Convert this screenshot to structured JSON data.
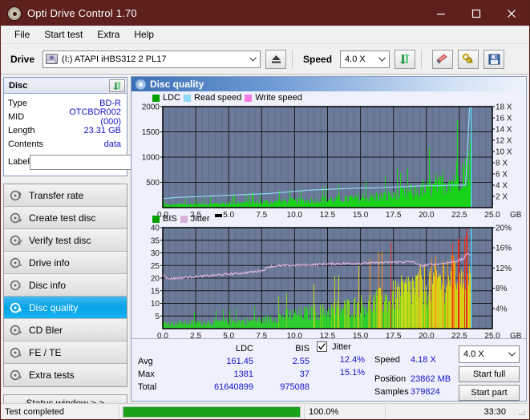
{
  "window": {
    "title": "Opti Drive Control 1.70",
    "icon": "disc-icon",
    "minimize": "minimize-icon",
    "maximize": "maximize-icon",
    "close": "close-icon",
    "titlebar_color": "#5e201c"
  },
  "menu": {
    "items": [
      "File",
      "Start test",
      "Extra",
      "Help"
    ]
  },
  "toolbar": {
    "drive_label": "Drive",
    "drive_value": "(I:)  ATAPI iHBS312   2 PL17",
    "eject_icon": "eject-icon",
    "speed_label": "Speed",
    "speed_value": "4.0 X",
    "refresh_icon": "refresh-icon",
    "eraser_icon": "eraser-icon",
    "keys_icon": "keys-icon",
    "save_icon": "save-icon"
  },
  "disc": {
    "header": "Disc",
    "refresh_icon": "refresh-icon",
    "rows": [
      {
        "key": "Type",
        "value": "BD-R"
      },
      {
        "key": "MID",
        "value": "OTCBDR002 (000)"
      },
      {
        "key": "Length",
        "value": "23.31 GB"
      },
      {
        "key": "Contents",
        "value": "data"
      }
    ],
    "label_key": "Label",
    "label_value": "",
    "label_button_icon": "disc-icon"
  },
  "nav": {
    "items": [
      {
        "label": "Transfer rate",
        "selected": false
      },
      {
        "label": "Create test disc",
        "selected": false
      },
      {
        "label": "Verify test disc",
        "selected": false
      },
      {
        "label": "Drive info",
        "selected": false
      },
      {
        "label": "Disc info",
        "selected": false
      },
      {
        "label": "Disc quality",
        "selected": true
      },
      {
        "label": "CD Bler",
        "selected": false
      },
      {
        "label": "FE / TE",
        "selected": false
      },
      {
        "label": "Extra tests",
        "selected": false
      }
    ],
    "status_window": "Status window > >"
  },
  "panel": {
    "title": "Disc quality",
    "icon": "disc-icon"
  },
  "results": {
    "col_ldc": "LDC",
    "col_bis": "BIS",
    "jitter_label": "Jitter",
    "jitter_checked": true,
    "rows": [
      {
        "name": "Avg",
        "ldc": "161.45",
        "bis": "2.55",
        "jitter": "12.4%"
      },
      {
        "name": "Max",
        "ldc": "1381",
        "bis": "37",
        "jitter": "15.1%"
      },
      {
        "name": "Total",
        "ldc": "61640899",
        "bis": "975088",
        "jitter": ""
      }
    ],
    "speed_label": "Speed",
    "speed_value": "4.18 X",
    "speed_select": "4.0 X",
    "position_label": "Position",
    "position_value": "23862 MB",
    "samples_label": "Samples",
    "samples_value": "379824",
    "start_full": "Start full",
    "start_part": "Start part"
  },
  "statusbar": {
    "message": "Test completed",
    "percent_text": "100.0%",
    "percent_value": 100,
    "elapsed": "33:30"
  },
  "chart_data": [
    {
      "type": "area",
      "id": "ldc-chart",
      "title": "",
      "xlabel": "GB",
      "ylabel": "",
      "xlim": [
        0,
        25.0
      ],
      "ylim": [
        0,
        2000
      ],
      "y2lim": [
        0,
        18
      ],
      "y2label": "X",
      "grid": true,
      "legend": [
        {
          "name": "LDC",
          "color": "#00a000"
        },
        {
          "name": "Read speed",
          "color": "#8fd8f5"
        },
        {
          "name": "Write speed",
          "color": "#f57ce0"
        }
      ],
      "xticks": [
        "0.0",
        "2.5",
        "5.0",
        "7.5",
        "10.0",
        "12.5",
        "15.0",
        "17.5",
        "20.0",
        "22.5",
        "25.0"
      ],
      "yticks": [
        "500",
        "1000",
        "1500",
        "2000"
      ],
      "y2ticks": [
        "2 X",
        "4 X",
        "6 X",
        "8 X",
        "10 X",
        "12 X",
        "14 X",
        "16 X",
        "18 X"
      ],
      "plot_bg": "#6b7a99",
      "series": [
        {
          "name": "LDC",
          "color": "#00c000",
          "x": [
            0.0,
            0.25,
            0.5,
            0.75,
            1.0,
            1.25,
            1.5,
            1.75,
            2.0,
            2.25,
            2.5,
            2.75,
            3.0,
            3.25,
            3.5,
            3.75,
            4.0,
            4.25,
            4.5,
            4.75,
            5.0,
            5.25,
            5.5,
            5.75,
            6.0,
            6.25,
            6.5,
            6.75,
            7.0,
            7.25,
            7.5,
            7.75,
            8.0,
            8.25,
            8.5,
            8.75,
            9.0,
            9.25,
            9.5,
            9.75,
            10.0,
            10.25,
            10.5,
            10.75,
            11.0,
            11.25,
            11.5,
            11.75,
            12.0,
            12.25,
            12.5,
            12.75,
            13.0,
            13.25,
            13.5,
            13.75,
            14.0,
            14.25,
            14.5,
            14.75,
            15.0,
            15.25,
            15.5,
            15.75,
            16.0,
            16.25,
            16.5,
            16.75,
            17.0,
            17.25,
            17.5,
            17.75,
            18.0,
            18.25,
            18.5,
            18.75,
            19.0,
            19.25,
            19.5,
            19.75,
            20.0,
            20.25,
            20.5,
            20.75,
            21.0,
            21.25,
            21.5,
            21.75,
            22.0,
            22.25,
            22.5,
            22.75,
            23.0,
            23.2,
            23.35
          ],
          "values": [
            70,
            80,
            70,
            85,
            75,
            90,
            80,
            95,
            85,
            100,
            90,
            105,
            95,
            110,
            100,
            115,
            105,
            120,
            110,
            125,
            115,
            130,
            120,
            135,
            125,
            140,
            130,
            145,
            135,
            150,
            140,
            155,
            145,
            165,
            150,
            175,
            155,
            185,
            160,
            190,
            165,
            195,
            170,
            200,
            175,
            205,
            180,
            215,
            185,
            225,
            190,
            235,
            195,
            245,
            200,
            255,
            210,
            265,
            220,
            280,
            230,
            295,
            240,
            310,
            250,
            330,
            265,
            350,
            280,
            375,
            300,
            400,
            320,
            430,
            345,
            465,
            370,
            505,
            400,
            550,
            440,
            600,
            490,
            665,
            545,
            740,
            615,
            830,
            700,
            940,
            800,
            1080,
            950,
            1250,
            1381
          ]
        },
        {
          "name": "Read speed",
          "color": "#8fd8f5",
          "x": [
            0.0,
            1.0,
            2.0,
            3.0,
            4.0,
            5.0,
            6.0,
            7.0,
            8.0,
            9.0,
            10.0,
            11.0,
            12.0,
            13.0,
            14.0,
            15.0,
            16.0,
            17.0,
            18.0,
            19.0,
            20.0,
            21.0,
            22.0,
            23.0,
            23.3
          ],
          "values": [
            1.6,
            1.8,
            1.9,
            2.0,
            2.1,
            2.2,
            2.3,
            2.4,
            2.5,
            2.7,
            2.9,
            3.1,
            3.2,
            3.3,
            3.4,
            3.5,
            3.5,
            3.6,
            3.7,
            3.8,
            3.9,
            3.9,
            4.0,
            4.0,
            18.0
          ],
          "axis": "right"
        }
      ]
    },
    {
      "type": "area",
      "id": "bis-jitter-chart",
      "title": "",
      "xlabel": "GB",
      "xlim": [
        0,
        25.0
      ],
      "ylim": [
        0,
        40
      ],
      "y2lim": [
        0,
        20
      ],
      "y2label": "%",
      "grid": true,
      "legend": [
        {
          "name": "BIS",
          "color": "#00a000"
        },
        {
          "name": "Jitter",
          "color": "#dcb0dc"
        }
      ],
      "xticks": [
        "0.0",
        "2.5",
        "5.0",
        "7.5",
        "10.0",
        "12.5",
        "15.0",
        "17.5",
        "20.0",
        "22.5",
        "25.0"
      ],
      "yticks": [
        "5",
        "10",
        "15",
        "20",
        "25",
        "30",
        "35",
        "40"
      ],
      "y2ticks": [
        "4%",
        "8%",
        "12%",
        "16%",
        "20%"
      ],
      "plot_bg": "#6b7a99",
      "series": [
        {
          "name": "BIS",
          "color": "gradient-green-yellow-red",
          "x": [
            0.0,
            0.5,
            1.0,
            1.5,
            2.0,
            2.5,
            3.0,
            3.5,
            4.0,
            4.5,
            5.0,
            5.5,
            6.0,
            6.5,
            7.0,
            7.5,
            8.0,
            8.5,
            9.0,
            9.5,
            10.0,
            10.5,
            11.0,
            11.5,
            12.0,
            12.5,
            13.0,
            13.5,
            14.0,
            14.5,
            15.0,
            15.5,
            16.0,
            16.5,
            17.0,
            17.5,
            18.0,
            18.5,
            19.0,
            19.5,
            20.0,
            20.5,
            21.0,
            21.5,
            22.0,
            22.5,
            23.0,
            23.2,
            23.35
          ],
          "values": [
            3,
            3,
            3,
            3.2,
            3.2,
            3.4,
            3.4,
            3.6,
            3.6,
            3.8,
            3.9,
            4.0,
            4.1,
            4.2,
            4.4,
            4.6,
            5.2,
            6.0,
            6.6,
            7.2,
            7.6,
            8.0,
            8.4,
            8.8,
            9.2,
            9.6,
            10.2,
            10.8,
            11.4,
            12.0,
            12.6,
            13.2,
            14.0,
            15.0,
            16.0,
            17.5,
            19.0,
            20.5,
            22.0,
            23.0,
            24.0,
            25.5,
            27.0,
            29.0,
            31.0,
            33.5,
            36.0,
            37,
            37
          ]
        },
        {
          "name": "Jitter",
          "color": "#dcb0dc",
          "x": [
            0.0,
            0.3,
            1.0,
            2.0,
            3.0,
            4.0,
            5.0,
            6.0,
            7.0,
            7.6,
            8.0,
            9.0,
            10.0,
            11.0,
            12.0,
            13.0,
            14.0,
            15.0,
            16.0,
            17.0,
            18.0,
            19.0,
            19.6,
            20.0,
            21.0,
            22.0,
            22.8,
            23.2,
            23.35
          ],
          "values": [
            22.0,
            19.8,
            20.0,
            20.4,
            20.8,
            21.2,
            21.6,
            22.0,
            22.6,
            23.0,
            24.6,
            24.9,
            25.1,
            25.2,
            25.5,
            25.7,
            25.8,
            25.9,
            26.0,
            26.2,
            26.4,
            26.5,
            24.8,
            25.2,
            25.6,
            26.4,
            27.5,
            30.2,
            29.0
          ],
          "axis": "left-scaled-jitter-percent"
        }
      ]
    }
  ]
}
